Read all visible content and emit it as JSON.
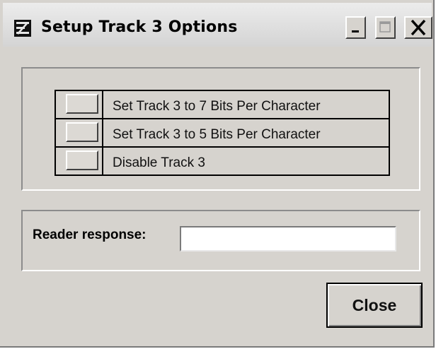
{
  "window": {
    "title": "Setup Track 3 Options",
    "icon": "app-logo-icon",
    "controls": [
      "minimize-icon",
      "maximize-icon",
      "close-icon"
    ]
  },
  "options": {
    "items": [
      {
        "label": "Set Track 3 to 7 Bits Per Character"
      },
      {
        "label": "Set Track 3 to 5 Bits Per Character"
      },
      {
        "label": "Disable Track 3"
      }
    ]
  },
  "response": {
    "label": "Reader response:",
    "value": ""
  },
  "actions": {
    "close_label": "Close"
  },
  "colors": {
    "window_bg": "#d6d3ce",
    "text": "#000000"
  }
}
